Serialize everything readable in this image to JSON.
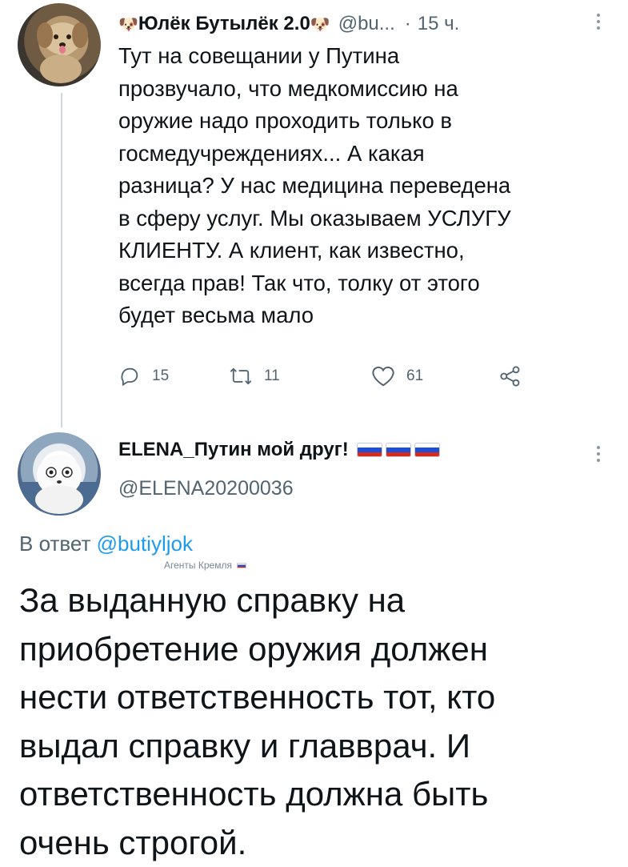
{
  "tweet1": {
    "display_name": "Юлёк Бутылёк 2.0",
    "name_emoji": "🐶",
    "handle": "@bu...",
    "separator": "·",
    "time": "15 ч.",
    "body_lines": [
      "Тут на совещании у Путина",
      "прозвучало, что медкомиссию на",
      "оружие надо проходить только в",
      "госмедучреждениях... А какая",
      "разница? У нас медицина переведена",
      "в сферу услуг. Мы оказываем УСЛУГУ",
      "КЛИЕНТУ. А клиент, как известно,",
      "всегда прав! Так что, толку от этого",
      "будет весьма мало"
    ],
    "actions": {
      "reply_count": "15",
      "retweet_count": "11",
      "like_count": "61"
    }
  },
  "tweet2": {
    "display_name": "ELENA_Путин мой друг!",
    "handle": "@ELENA20200036",
    "reply_prefix": "В ответ",
    "reply_to": "@butiyljok",
    "watermark": "Агенты Кремля",
    "body_lines": [
      "За выданную справку на",
      "приобретение оружия должен",
      "нести ответственность тот, кто",
      "выдал справку и главврач. И",
      "ответственность должна быть",
      "очень строгой."
    ]
  },
  "icons": {
    "reply": "reply-icon",
    "retweet": "retweet-icon",
    "like": "heart-icon",
    "share": "share-icon",
    "more": "more-vertical-icon",
    "flag": "russian-flag-icon"
  },
  "colors": {
    "text": "#0f1419",
    "secondary": "#536471",
    "link": "#1d9bf0",
    "thread_line": "#cfd9de"
  }
}
